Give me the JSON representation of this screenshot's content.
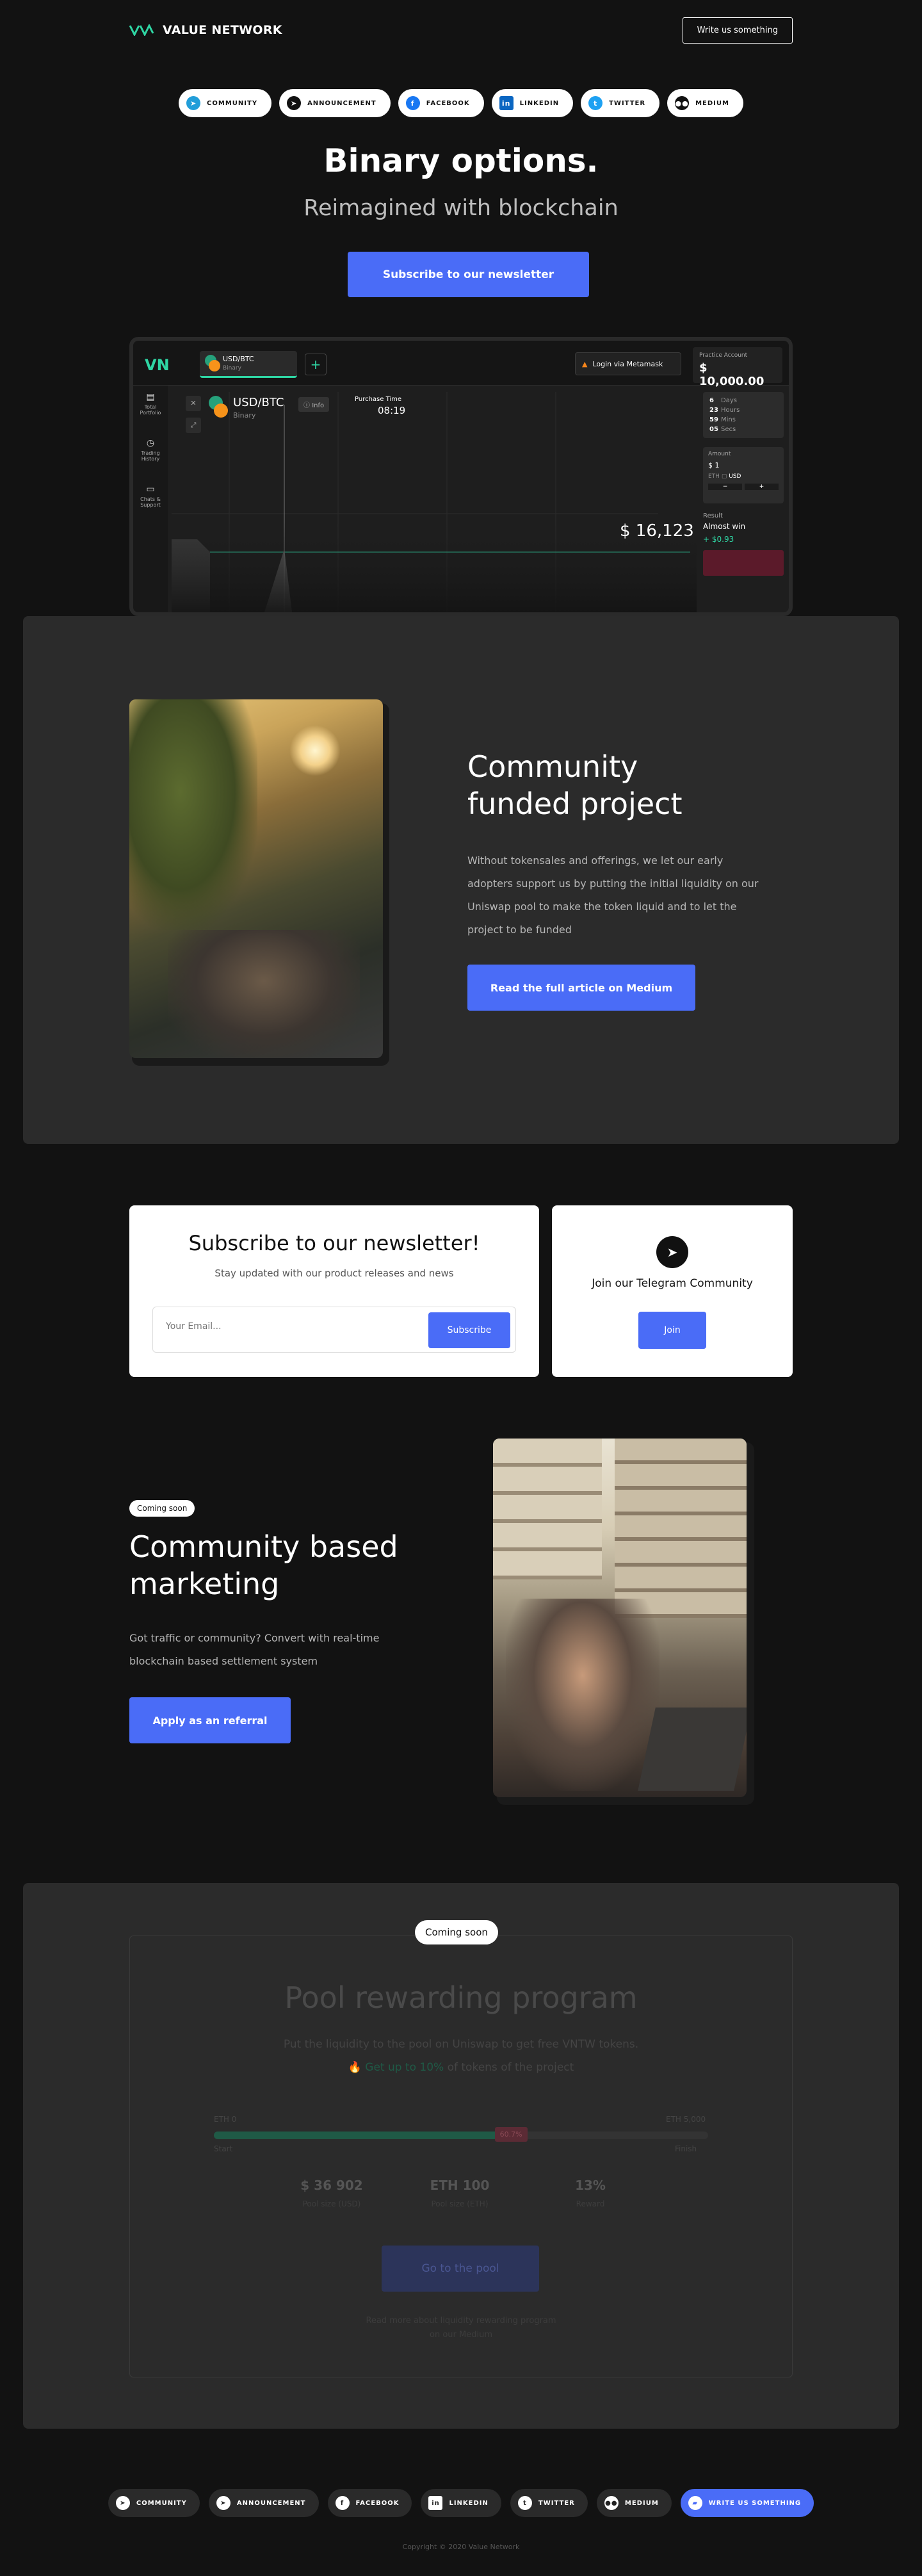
{
  "header": {
    "brand": "VALUE NETWORK",
    "cta": "Write us something"
  },
  "social": [
    {
      "label": "COMMUNITY",
      "icon": "telegram-icon",
      "color": "#229ED9"
    },
    {
      "label": "ANNOUNCEMENT",
      "icon": "telegram-icon",
      "color": "#111111"
    },
    {
      "label": "FACEBOOK",
      "icon": "facebook-icon",
      "color": "#1877F2"
    },
    {
      "label": "LINKEDIN",
      "icon": "linkedin-icon",
      "color": "#0A66C2"
    },
    {
      "label": "TWITTER",
      "icon": "twitter-icon",
      "color": "#1DA1F2"
    },
    {
      "label": "MEDIUM",
      "icon": "medium-icon",
      "color": "#111111"
    }
  ],
  "hero": {
    "title": "Binary options.",
    "subtitle": "Reimagined with blockchain",
    "button": "Subscribe to our newsletter"
  },
  "mock": {
    "tab_pair": "USD/BTC",
    "tab_type": "Binary",
    "login": "Login via Metamask",
    "account_label": "Practice Account",
    "account_value": "$ 10,000.00",
    "side": [
      "Total Portfolio",
      "Trading History",
      "Chats & Support"
    ],
    "pair": "USD/BTC",
    "pair_type": "Binary",
    "info": "Info",
    "purchase_label": "Purchase Time",
    "purchase_time": "08:19",
    "price": "$ 16,123",
    "timer": [
      {
        "v": "6",
        "u": "Days"
      },
      {
        "v": "23",
        "u": "Hours"
      },
      {
        "v": "59",
        "u": "Mins"
      },
      {
        "v": "05",
        "u": "Secs"
      }
    ],
    "amount_label": "Amount",
    "amount_value": "$ 1",
    "eth": "ETH",
    "usd": "USD",
    "result_label": "Result",
    "result_text": "Almost win",
    "result_value": "+ $0.93"
  },
  "community": {
    "title": "Community funded project",
    "text": "Without tokensales and offerings,  we let our early adopters support us by putting the initial liquidity on our Uniswap pool to make the token liquid and to let the project to be funded",
    "button": "Read the full article on Medium"
  },
  "newsletter": {
    "title": "Subscribe to our newsletter!",
    "subtitle": "Stay updated with our product releases and news",
    "placeholder": "Your Email...",
    "button": "Subscribe"
  },
  "telegram": {
    "text": "Join our Telegram Community",
    "button": "Join"
  },
  "marketing": {
    "badge": "Coming soon",
    "title": "Community based marketing",
    "text": "Got traffic or community? Convert with real-time blockchain based settlement system",
    "button": "Apply as an referral"
  },
  "pool": {
    "badge": "Coming soon",
    "title": "Pool rewarding program",
    "text1": "Put the liquidity to the pool on Uniswap to get free VNTW tokens.",
    "text2_prefix": "Get up to 10%",
    "text2_suffix": " of tokens of the project",
    "bar_left": "ETH 0",
    "bar_right": "ETH 5,000",
    "bar_left_sub": "Start",
    "bar_right_sub": "Finish",
    "bar_pct": "60.7%",
    "progress": 0.607,
    "stats": [
      {
        "value": "$ 36 902",
        "label": "Pool size (USD)"
      },
      {
        "value": "ETH 100",
        "label": "Pool size (ETH)"
      },
      {
        "value": "13%",
        "label": "Reward"
      }
    ],
    "button": "Go to the pool",
    "foot1": "Read more about liquidity rewarding program",
    "foot2": "on our Medium"
  },
  "footer": {
    "pills": [
      "COMMUNITY",
      "ANNOUNCEMENT",
      "FACEBOOK",
      "LINKEDIN",
      "TWITTER",
      "MEDIUM",
      "WRITE US SOMETHING"
    ],
    "copyright": "Copyright © 2020 Value Network"
  },
  "colors": {
    "accent": "#4a6cf7",
    "green": "#2fd6a4",
    "bg": "#121212",
    "card": "#2b2b2b"
  }
}
